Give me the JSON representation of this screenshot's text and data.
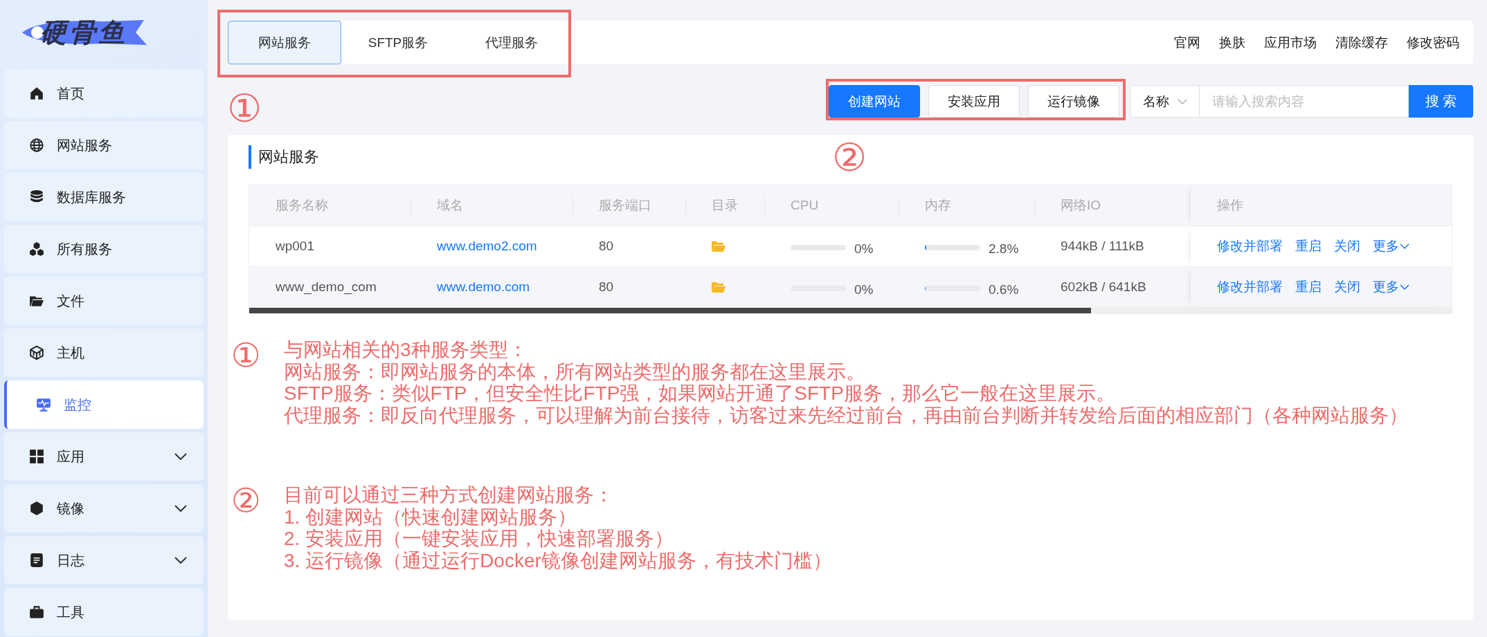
{
  "logo": {
    "text": "硬骨鱼"
  },
  "sidebar": {
    "items": [
      {
        "label": "首页",
        "kind": "link",
        "selected": false
      },
      {
        "label": "网站服务",
        "kind": "link",
        "selected": false
      },
      {
        "label": "数据库服务",
        "kind": "link",
        "selected": false
      },
      {
        "label": "所有服务",
        "kind": "link",
        "selected": false
      },
      {
        "label": "文件",
        "kind": "link",
        "selected": false
      },
      {
        "label": "主机",
        "kind": "link",
        "selected": false
      },
      {
        "label": "监控",
        "kind": "link",
        "selected": true
      },
      {
        "label": "应用",
        "kind": "group",
        "selected": false
      },
      {
        "label": "镜像",
        "kind": "group",
        "selected": false
      },
      {
        "label": "日志",
        "kind": "group",
        "selected": false
      },
      {
        "label": "工具",
        "kind": "link",
        "selected": false
      }
    ]
  },
  "tabs": [
    {
      "label": "网站服务",
      "selected": true
    },
    {
      "label": "SFTP服务",
      "selected": false
    },
    {
      "label": "代理服务",
      "selected": false
    }
  ],
  "top_links": [
    "官网",
    "换肤",
    "应用市场",
    "清除缓存",
    "修改密码"
  ],
  "toolbar": {
    "buttons": [
      {
        "label": "创建网站",
        "kind": "primary"
      },
      {
        "label": "安装应用",
        "kind": "default"
      },
      {
        "label": "运行镜像",
        "kind": "default"
      }
    ],
    "search": {
      "field": "名称",
      "placeholder": "请输入搜索内容",
      "button": "搜 索"
    }
  },
  "card": {
    "title": "网站服务",
    "table": {
      "columns": [
        "服务名称",
        "域名",
        "服务端口",
        "目录",
        "CPU",
        "内存",
        "网络IO",
        "操作"
      ],
      "rows": [
        {
          "name": "wp001",
          "domain": "www.demo2.com",
          "port": "80",
          "cpu": {
            "level": 0,
            "reading": "0%"
          },
          "memory": {
            "level": 0.028,
            "reading": "2.8%"
          },
          "network_io": "944kB / 111kB",
          "actions": [
            "修改并部署",
            "重启",
            "关闭",
            "更多"
          ]
        },
        {
          "name": "www_demo_com",
          "domain": "www.demo.com",
          "port": "80",
          "cpu": {
            "level": 0,
            "reading": "0%"
          },
          "memory": {
            "level": 0.006,
            "reading": "0.6%"
          },
          "network_io": "602kB / 641kB",
          "actions": [
            "修改并部署",
            "重启",
            "关闭",
            "更多"
          ]
        }
      ]
    },
    "notes": [
      {
        "marker": "①",
        "lines": [
          "与网站相关的3种服务类型：",
          "网站服务：即网站服务的本体，所有网站类型的服务都在这里展示。",
          "SFTP服务：类似FTP，但安全性比FTP强，如果网站开通了SFTP服务，那么它一般在这里展示。",
          "代理服务：即反向代理服务，可以理解为前台接待，访客过来先经过前台，再由前台判断并转发给后面的相应部门（各种网站服务）"
        ]
      },
      {
        "marker": "②",
        "lines": [
          "目前可以通过三种方式创建网站服务：",
          "1. 创建网站（快速创建网站服务）",
          "2. 安装应用（一键安装应用，快速部署服务）",
          "3. 运行镜像（通过运行Docker镜像创建网站服务，有技术门槛）"
        ]
      }
    ]
  },
  "callouts": [
    {
      "marker": "①"
    },
    {
      "marker": "②"
    }
  ]
}
